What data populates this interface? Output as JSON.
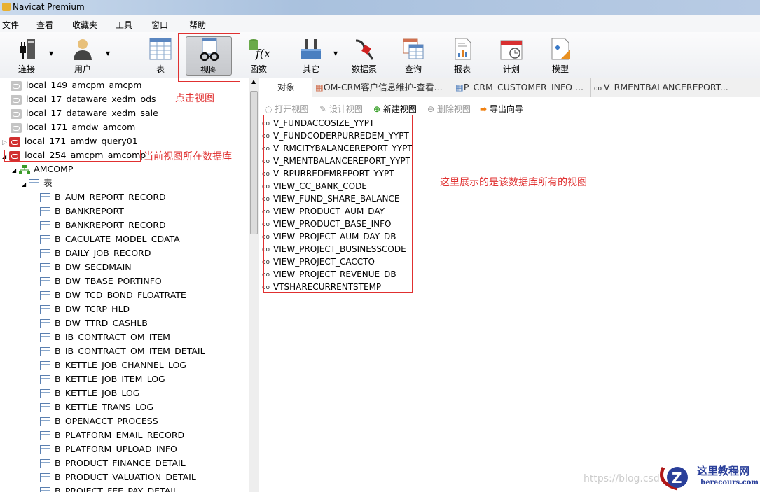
{
  "window": {
    "title": "Navicat Premium"
  },
  "menu": [
    "文件",
    "查看",
    "收藏夹",
    "工具",
    "窗口",
    "帮助"
  ],
  "toolbar": [
    {
      "label": "连接",
      "icon": "plug-server-icon"
    },
    {
      "label": "用户",
      "icon": "user-icon"
    },
    {
      "label": "表",
      "icon": "table-icon"
    },
    {
      "label": "视图",
      "icon": "view-glasses-icon"
    },
    {
      "label": "函数",
      "icon": "function-icon"
    },
    {
      "label": "其它",
      "icon": "tools-icon"
    },
    {
      "label": "数据泵",
      "icon": "fuel-pump-icon"
    },
    {
      "label": "查询",
      "icon": "query-icon"
    },
    {
      "label": "报表",
      "icon": "report-icon"
    },
    {
      "label": "计划",
      "icon": "calendar-icon"
    },
    {
      "label": "模型",
      "icon": "model-icon"
    }
  ],
  "annotations": {
    "click_view": "点击视图",
    "current_db": "当前视图所在数据库",
    "all_views": "这里展示的是该数据库所有的视图"
  },
  "tree": {
    "connections": [
      {
        "name": "local_149_amcpm_amcpm",
        "open": false
      },
      {
        "name": "local_17_dataware_xedm_ods",
        "open": false
      },
      {
        "name": "local_17_dataware_xedm_sale",
        "open": false
      },
      {
        "name": "local_171_amdw_amcom",
        "open": false
      },
      {
        "name": "local_171_amdw_query01",
        "open": true
      },
      {
        "name": "local_254_amcpm_amcomp",
        "open": true
      }
    ],
    "schema": "AMCOMP",
    "tables_label": "表",
    "tables": [
      "B_AUM_REPORT_RECORD",
      "B_BANKREPORT",
      "B_BANKREPORT_RECORD",
      "B_CACULATE_MODEL_CDATA",
      "B_DAILY_JOB_RECORD",
      "B_DW_SECDMAIN",
      "B_DW_TBASE_PORTINFO",
      "B_DW_TCD_BOND_FLOATRATE",
      "B_DW_TCRP_HLD",
      "B_DW_TTRD_CASHLB",
      "B_IB_CONTRACT_OM_ITEM",
      "B_IB_CONTRACT_OM_ITEM_DETAIL",
      "B_KETTLE_JOB_CHANNEL_LOG",
      "B_KETTLE_JOB_ITEM_LOG",
      "B_KETTLE_JOB_LOG",
      "B_KETTLE_TRANS_LOG",
      "B_OPENACCT_PROCESS",
      "B_PLATFORM_EMAIL_RECORD",
      "B_PLATFORM_UPLOAD_INFO",
      "B_PRODUCT_FINANCE_DETAIL",
      "B_PRODUCT_VALUATION_DETAIL",
      "B_PROJECT_FEE_PAY_DETAIL"
    ]
  },
  "tabs": [
    "对象",
    "OM-CRM客户信息维护-查看...",
    "P_CRM_CUSTOMER_INFO ...",
    "V_RMENTBALANCEREPORT..."
  ],
  "object_toolbar": {
    "open": "打开视图",
    "design": "设计视图",
    "new": "新建视图",
    "delete": "删除视图",
    "export": "导出向导"
  },
  "views": [
    "V_FUNDACCOSIZE_YYPT",
    "V_FUNDCODERPURREDEM_YYPT",
    "V_RMCITYBALANCEREPORT_YYPT",
    "V_RMENTBALANCEREPORT_YYPT",
    "V_RPURREDEMREPORT_YYPT",
    "VIEW_CC_BANK_CODE",
    "VIEW_FUND_SHARE_BALANCE",
    "VIEW_PRODUCT_AUM_DAY",
    "VIEW_PRODUCT_BASE_INFO",
    "VIEW_PROJECT_AUM_DAY_DB",
    "VIEW_PROJECT_BUSINESSCODE",
    "VIEW_PROJECT_CACCTO",
    "VIEW_PROJECT_REVENUE_DB",
    "VTSHARECURRENTSTEMP"
  ],
  "watermark": {
    "url": "https://blog.csd",
    "brand": "这里教程网",
    "domain": "herecours.com"
  }
}
